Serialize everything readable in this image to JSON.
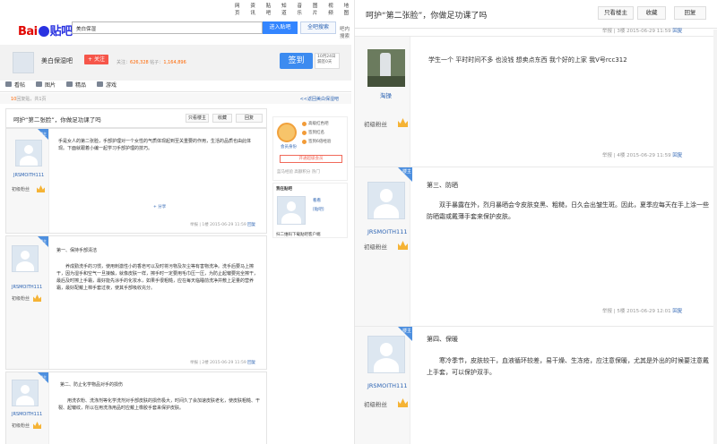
{
  "top_links": [
    "网页",
    "资讯",
    "贴吧",
    "知道",
    "音乐",
    "图片",
    "视频",
    "地图"
  ],
  "logo": {
    "bai": "Bai",
    "du": "du",
    "tieba": "贴吧"
  },
  "search": {
    "value": "美白保湿",
    "enter_label": "进入贴吧",
    "all_label": "全吧搜索",
    "advanced_label": "吧内搜索"
  },
  "forum": {
    "name": "美白保湿吧",
    "follow_label": "+ 关注",
    "stats": "关注：",
    "fans": "626,328",
    "posts_label": "帖子：",
    "posts": "1,164,896",
    "sign_label": "签到",
    "sign_info": "10月24日 漏签0天"
  },
  "tabs": [
    {
      "icon": "doc-icon",
      "label": "看帖"
    },
    {
      "icon": "image-icon",
      "label": "图片"
    },
    {
      "icon": "star-icon",
      "label": "精品"
    },
    {
      "icon": "game-icon",
      "label": "游戏"
    }
  ],
  "listbar": {
    "count_prefix": "10",
    "count_text": "回复贴，共1页",
    "back": "<<返回美白保湿吧"
  },
  "thread": {
    "title": "呵护“第二张脸”，你做足功课了吗",
    "only_op": "只看楼主",
    "collect": "收藏",
    "reply": "回复"
  },
  "sidebar": {
    "medal_label": "会员身份",
    "items": [
      "高级红色吧",
      "签到红名",
      "签到6倍经验"
    ],
    "join": "开通超级会员",
    "footer": "蓝马经验 高额积分 热门",
    "mine_title": "我在贴吧",
    "mine_links": [
      "看看",
      "[贴吧]"
    ],
    "bottom": "扫二维码下载贴吧客户端"
  },
  "left_posts": [
    {
      "user": "JRSMOITH111",
      "level": "初级粉丝",
      "badge": "楼主",
      "text": [
        "手是女人的第二张脸，手部护理对一个女性的气质体现起到至关重要的作用，生活的品质也由此体现。下面就跟着小编一起学习手部护理的技巧。"
      ],
      "share": "分享",
      "tail": "举报 | 1楼  2015-06-29 11:59",
      "reply": "回复"
    },
    {
      "user": "JRSMOITH111",
      "level": "初级粉丝",
      "badge": "楼主",
      "heading": "第一、保持手部清洁",
      "text": [
        "养成勤洗手的习惯，使用刺激性小的香皂可以及时将污物及灰尘等有害物洗净。洗手后要马上擦干，因为湿手和空气一旦接触，就像皮肤一样，擦手时一定要用毛巾压一压，为防止起皱要完全擦干，最后及时擦上手霜，最好能先涂手的化妆水，如果手很粗糙，应在每天临睡前洗净并敷上足量的营养霜，最好配戴上棉手套过夜，使其手部吸收充分。"
      ],
      "tail": "举报 | 2楼  2015-06-29 11:59",
      "reply": "回复"
    },
    {
      "user": "JRSMOITH111",
      "level": "初级粉丝",
      "badge": "楼主",
      "heading": "第二、防止化学物品对手的损伤",
      "text": [
        "用洗衣粉、洗涤剂等化学洗剂对手部皮肤的损伤极大，时间久了会加速皮肤老化，使皮肤粗糙、干裂、起皱纹，所以在用洗涤用品时应戴上橡胶手套来保护皮肤。"
      ]
    }
  ],
  "right": {
    "posts": [
      {
        "user": "淘操",
        "level": "初级粉丝",
        "text": "学生一个 平时时间不多 也没钱 想卖点东西 我个好的上家 我V号rcc312",
        "tail": "举报 | 3楼  2015-06-29 11:59",
        "reply": "回复"
      },
      {
        "user": "JRSMOITH111",
        "level": "初级粉丝",
        "badge": "楼主",
        "heading": "第三、防晒",
        "text": "双手暴露在外，烈月暴晒会令皮肤变黑、粗糙，日久会出皱生斑。因此，夏季应每天在手上涂一些防晒霜或戴薄手套来保护皮肤。",
        "tail_top": "举报 | 4楼  2015-06-29 11:59",
        "reply_top": "回复",
        "tail": "举报 | 5楼  2015-06-29 12:01",
        "reply": "回复"
      },
      {
        "user": "JRSMOITH111",
        "level": "初级粉丝",
        "badge": "楼主",
        "heading": "第四、保暖",
        "text": "寒冷季节，皮肤较干，血液循环较差，易干燥、生冻疮，应注意保暖，尤其是外出的时候要注意戴上手套，可以保护双手。"
      }
    ]
  }
}
